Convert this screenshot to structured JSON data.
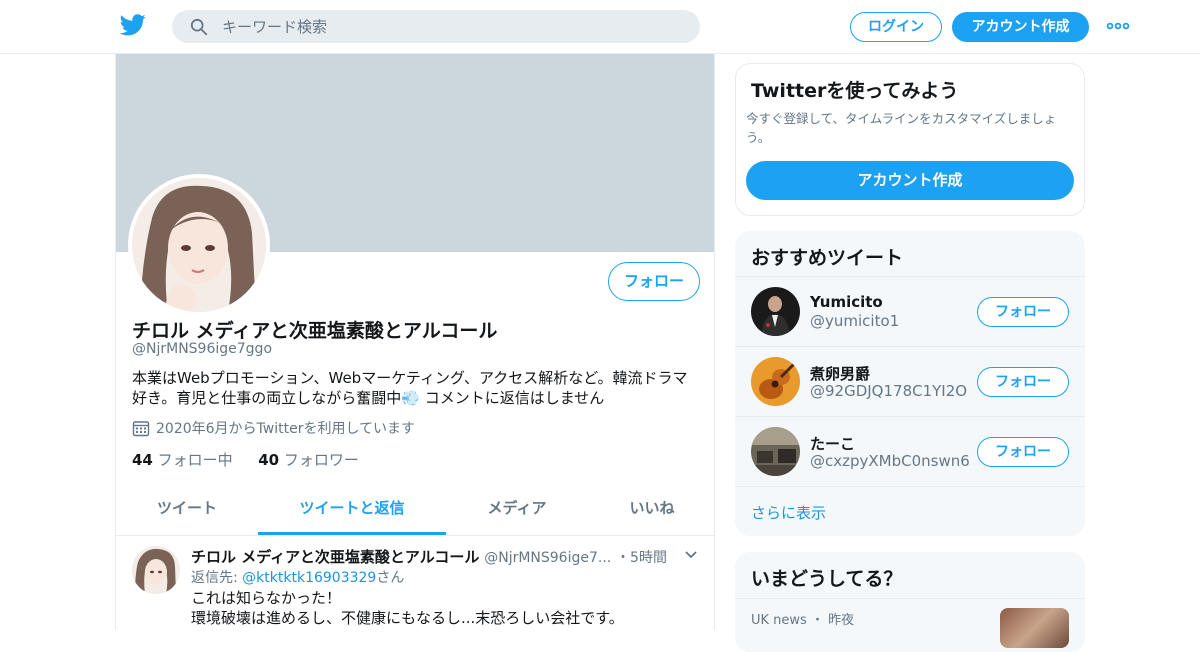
{
  "header": {
    "search_placeholder": "キーワード検索",
    "login_label": "ログイン",
    "signup_label": "アカウント作成",
    "brand_color": "#1da1f2"
  },
  "profile": {
    "name": "チロル メディアと次亜塩素酸とアルコール",
    "handle": "@NjrMNS96ige7ggo",
    "bio": "本業はWebプロモーション、Webマーケティング、アクセス解析など。韓流ドラマ好き。育児と仕事の両立しながら奮闘中💨 コメントに返信はしません",
    "joined": "2020年6月からTwitterを利用しています",
    "following_count": "44",
    "following_label": "フォロー中",
    "followers_count": "40",
    "followers_label": "フォロワー",
    "follow_label": "フォロー"
  },
  "tabs": [
    {
      "label": "ツイート"
    },
    {
      "label": "ツイートと返信",
      "active": true
    },
    {
      "label": "メディア"
    },
    {
      "label": "いいね"
    }
  ],
  "tweet": {
    "name": "チロル メディアと次亜塩素酸とアルコール",
    "handle": "@NjrMNS96ige7...",
    "time": "・5時間",
    "reply_prefix": "返信先: ",
    "reply_to": "@ktktktk16903329",
    "reply_suffix": "さん",
    "line1": "これは知らなかった！",
    "line2": "環境破壊は進めるし、不健康にもなるし...末恐ろしい会社です。"
  },
  "signup_card": {
    "title": "Twitterを使ってみよう",
    "text": "今すぐ登録して、タイムラインをカスタマイズしましょう。",
    "cta": "アカウント作成"
  },
  "recommend": {
    "title": "おすすめツイート",
    "users": [
      {
        "name": "Yumicito",
        "handle": "@yumicito1",
        "follow": "フォロー"
      },
      {
        "name": "煮卵男爵",
        "handle": "@92GDJQ178C1YI2O",
        "follow": "フォロー"
      },
      {
        "name": "たーこ",
        "handle": "@cxzpyXMbC0nswn6",
        "follow": "フォロー"
      }
    ],
    "show_more": "さらに表示"
  },
  "trends": {
    "title": "いまどうしてる？",
    "meta": "UK news ・ 昨夜"
  }
}
